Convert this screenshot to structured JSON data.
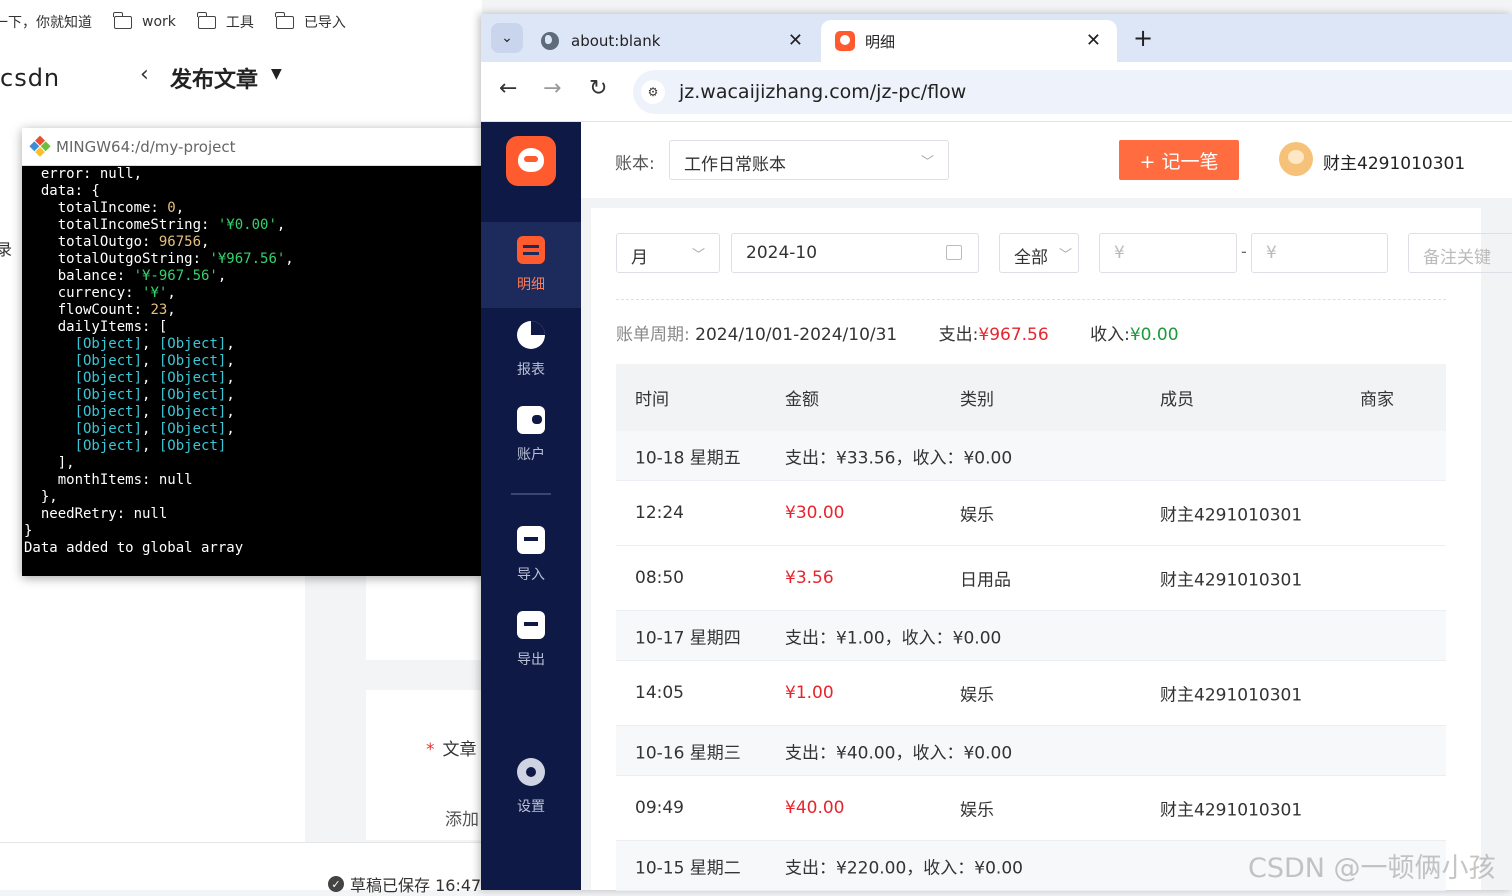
{
  "background": {
    "bookmarks": [
      {
        "label": "一下，你就知道",
        "folder": false
      },
      {
        "label": "work",
        "folder": true
      },
      {
        "label": "工具",
        "folder": true
      },
      {
        "label": "已导入",
        "folder": true
      }
    ],
    "logo_text": "csdn",
    "publish_title": "发布文章",
    "sidebar_char": "录",
    "article_label": "文章",
    "add_label": "添加",
    "draft_status": "草稿已保存 16:47"
  },
  "terminal": {
    "title": "MINGW64:/d/my-project",
    "lines": [
      [
        {
          "t": "  error: ",
          "c": "white"
        },
        {
          "t": "null",
          "c": "white"
        },
        {
          "t": ",",
          "c": "white"
        }
      ],
      [
        {
          "t": "  data: {",
          "c": "white"
        }
      ],
      [
        {
          "t": "    totalIncome: ",
          "c": "white"
        },
        {
          "t": "0",
          "c": "yellow"
        },
        {
          "t": ",",
          "c": "white"
        }
      ],
      [
        {
          "t": "    totalIncomeString: ",
          "c": "white"
        },
        {
          "t": "'¥0.00'",
          "c": "green"
        },
        {
          "t": ",",
          "c": "white"
        }
      ],
      [
        {
          "t": "    totalOutgo: ",
          "c": "white"
        },
        {
          "t": "96756",
          "c": "yellow"
        },
        {
          "t": ",",
          "c": "white"
        }
      ],
      [
        {
          "t": "    totalOutgoString: ",
          "c": "white"
        },
        {
          "t": "'¥967.56'",
          "c": "green"
        },
        {
          "t": ",",
          "c": "white"
        }
      ],
      [
        {
          "t": "    balance: ",
          "c": "white"
        },
        {
          "t": "'¥-967.56'",
          "c": "green"
        },
        {
          "t": ",",
          "c": "white"
        }
      ],
      [
        {
          "t": "    currency: ",
          "c": "white"
        },
        {
          "t": "'¥'",
          "c": "green"
        },
        {
          "t": ",",
          "c": "white"
        }
      ],
      [
        {
          "t": "    flowCount: ",
          "c": "white"
        },
        {
          "t": "23",
          "c": "yellow"
        },
        {
          "t": ",",
          "c": "white"
        }
      ],
      [
        {
          "t": "    dailyItems: [",
          "c": "white"
        }
      ],
      [
        {
          "t": "      ",
          "c": "white"
        },
        {
          "t": "[Object]",
          "c": "cyan"
        },
        {
          "t": ", ",
          "c": "white"
        },
        {
          "t": "[Object]",
          "c": "cyan"
        },
        {
          "t": ",",
          "c": "white"
        }
      ],
      [
        {
          "t": "      ",
          "c": "white"
        },
        {
          "t": "[Object]",
          "c": "cyan"
        },
        {
          "t": ", ",
          "c": "white"
        },
        {
          "t": "[Object]",
          "c": "cyan"
        },
        {
          "t": ",",
          "c": "white"
        }
      ],
      [
        {
          "t": "      ",
          "c": "white"
        },
        {
          "t": "[Object]",
          "c": "cyan"
        },
        {
          "t": ", ",
          "c": "white"
        },
        {
          "t": "[Object]",
          "c": "cyan"
        },
        {
          "t": ",",
          "c": "white"
        }
      ],
      [
        {
          "t": "      ",
          "c": "white"
        },
        {
          "t": "[Object]",
          "c": "cyan"
        },
        {
          "t": ", ",
          "c": "white"
        },
        {
          "t": "[Object]",
          "c": "cyan"
        },
        {
          "t": ",",
          "c": "white"
        }
      ],
      [
        {
          "t": "      ",
          "c": "white"
        },
        {
          "t": "[Object]",
          "c": "cyan"
        },
        {
          "t": ", ",
          "c": "white"
        },
        {
          "t": "[Object]",
          "c": "cyan"
        },
        {
          "t": ",",
          "c": "white"
        }
      ],
      [
        {
          "t": "      ",
          "c": "white"
        },
        {
          "t": "[Object]",
          "c": "cyan"
        },
        {
          "t": ", ",
          "c": "white"
        },
        {
          "t": "[Object]",
          "c": "cyan"
        },
        {
          "t": ",",
          "c": "white"
        }
      ],
      [
        {
          "t": "      ",
          "c": "white"
        },
        {
          "t": "[Object]",
          "c": "cyan"
        },
        {
          "t": ", ",
          "c": "white"
        },
        {
          "t": "[Object]",
          "c": "cyan"
        }
      ],
      [
        {
          "t": "    ],",
          "c": "white"
        }
      ],
      [
        {
          "t": "    monthItems: ",
          "c": "white"
        },
        {
          "t": "null",
          "c": "white"
        }
      ],
      [
        {
          "t": "  },",
          "c": "white"
        }
      ],
      [
        {
          "t": "  needRetry: ",
          "c": "white"
        },
        {
          "t": "null",
          "c": "white"
        }
      ],
      [
        {
          "t": "}",
          "c": "white"
        }
      ],
      [
        {
          "t": "Data added to global array",
          "c": "white"
        }
      ]
    ]
  },
  "chrome": {
    "tabs": [
      {
        "title": "about:blank",
        "icon": "globe-icon"
      },
      {
        "title": "明细",
        "icon": "app-favicon"
      }
    ],
    "url": "jz.wacaijizhang.com/jz-pc/flow"
  },
  "app": {
    "nav": [
      {
        "label": "明细",
        "icon": "list-icon",
        "active": true
      },
      {
        "label": "报表",
        "icon": "pie-chart-icon",
        "active": false
      },
      {
        "label": "账户",
        "icon": "wallet-icon",
        "active": false
      },
      {
        "label": "导入",
        "icon": "import-icon",
        "active": false
      },
      {
        "label": "导出",
        "icon": "export-icon",
        "active": false
      },
      {
        "label": "设置",
        "icon": "gear-icon",
        "active": false
      }
    ],
    "book_label": "账本:",
    "book_value": "工作日常账本",
    "add_button": "+ 记一笔",
    "username": "财主4291010301",
    "filters": {
      "period": "月",
      "month": "2024-10",
      "type": "全部",
      "min_placeholder": "¥",
      "max_placeholder": "¥",
      "range_sep": "-",
      "note_placeholder": "备注关键"
    },
    "summary": {
      "period_label": "账单周期:",
      "period_value": "2024/10/01-2024/10/31",
      "expense_label": "支出:",
      "expense_value": "¥967.56",
      "income_label": "收入:",
      "income_value": "¥0.00"
    },
    "table": {
      "columns": [
        "时间",
        "金额",
        "类别",
        "成员",
        "商家"
      ],
      "rows": [
        {
          "kind": "day",
          "date": "10-18 星期五",
          "summary": "支出：¥33.56，收入：¥0.00"
        },
        {
          "kind": "item",
          "time": "12:24",
          "amount": "¥30.00",
          "category": "娱乐",
          "member": "财主4291010301",
          "merchant": ""
        },
        {
          "kind": "item",
          "time": "08:50",
          "amount": "¥3.56",
          "category": "日用品",
          "member": "财主4291010301",
          "merchant": ""
        },
        {
          "kind": "day",
          "date": "10-17 星期四",
          "summary": "支出：¥1.00，收入：¥0.00"
        },
        {
          "kind": "item",
          "time": "14:05",
          "amount": "¥1.00",
          "category": "娱乐",
          "member": "财主4291010301",
          "merchant": ""
        },
        {
          "kind": "day",
          "date": "10-16 星期三",
          "summary": "支出：¥40.00，收入：¥0.00"
        },
        {
          "kind": "item",
          "time": "09:49",
          "amount": "¥40.00",
          "category": "娱乐",
          "member": "财主4291010301",
          "merchant": ""
        },
        {
          "kind": "day",
          "date": "10-15 星期二",
          "summary": "支出：¥220.00，收入：¥0.00"
        }
      ]
    }
  },
  "watermark": "CSDN @一顿俩小孩",
  "colors": {
    "accent": "#ff6c3f",
    "sidebar": "#0e1a45",
    "expense": "#e8242c",
    "income": "#1a9a3a"
  }
}
